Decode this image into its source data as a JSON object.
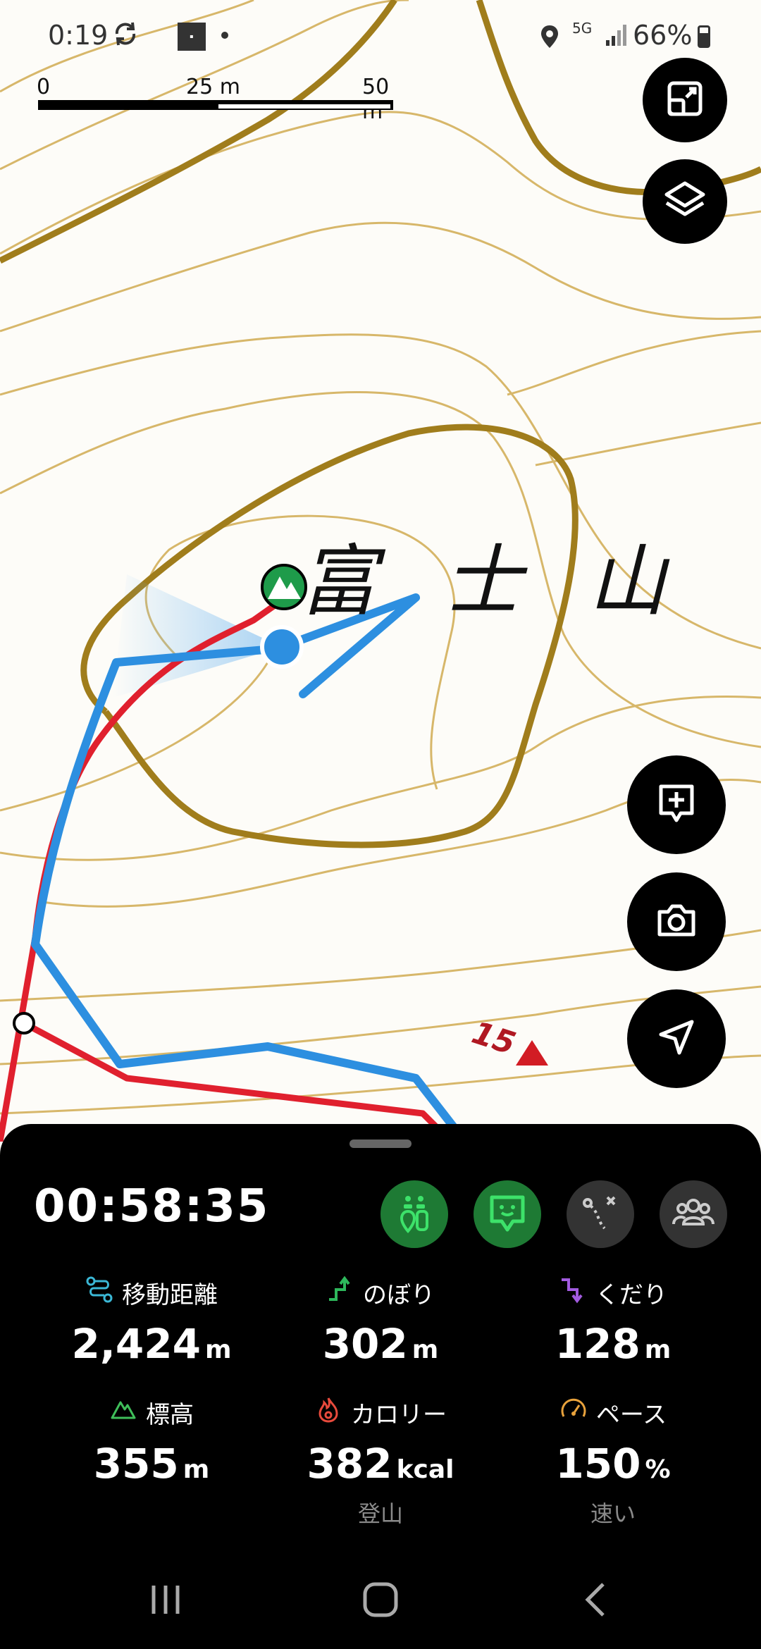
{
  "status_bar": {
    "time": "0:19",
    "network": "5G",
    "battery_percent": "66%",
    "icons": [
      "sync-icon",
      "app-notification-icon",
      "location-icon",
      "signal-icon",
      "battery-icon"
    ]
  },
  "map": {
    "scale": {
      "start": "0",
      "mid": "25 m",
      "end": "50 m"
    },
    "peak_name": "富 士 山",
    "elevation_marker": "15",
    "colors": {
      "contour": "#a07d1c",
      "contour_light": "#d7b76a",
      "route_planned": "#e0202e",
      "track_actual": "#2d8fe0",
      "current_location": "#2d8fe0",
      "summit_badge": "#1e9b4a"
    }
  },
  "map_buttons": {
    "top": [
      "expand-map-icon",
      "layers-icon"
    ],
    "bottom": [
      "add-memo-icon",
      "camera-icon",
      "navigate-icon"
    ]
  },
  "panel": {
    "timer": "00:58:35",
    "buttons": [
      {
        "name": "group-pins",
        "active": true
      },
      {
        "name": "yamap-face",
        "active": true
      },
      {
        "name": "route-check",
        "active": false
      },
      {
        "name": "companions",
        "active": false
      }
    ],
    "stats": {
      "distance": {
        "label": "移動距離",
        "value": "2,424",
        "unit": "m"
      },
      "ascent": {
        "label": "のぼり",
        "value": "302",
        "unit": "m"
      },
      "descent": {
        "label": "くだり",
        "value": "128",
        "unit": "m"
      },
      "elevation": {
        "label": "標高",
        "value": "355",
        "unit": "m"
      },
      "calories": {
        "label": "カロリー",
        "value": "382",
        "unit": "kcal",
        "sub": "登山"
      },
      "pace": {
        "label": "ペース",
        "value": "150",
        "unit": "%",
        "sub": "速い"
      }
    },
    "colors": {
      "accent_green": "#1e7a34",
      "distance_icon": "#3bb8d6",
      "ascent_icon": "#2eb85c",
      "descent_icon": "#a25be0",
      "elevation_icon": "#3fbf5a",
      "calorie_icon": "#e84a3c",
      "pace_icon": "#e8a23c"
    }
  },
  "system_nav": [
    "recent-apps-icon",
    "home-icon",
    "back-icon"
  ]
}
